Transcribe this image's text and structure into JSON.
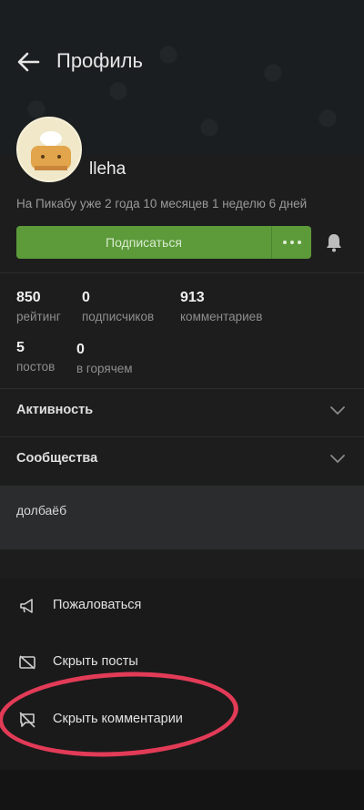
{
  "header": {
    "title": "Профиль",
    "back_icon": "arrow-left-icon"
  },
  "profile": {
    "username": "lleha",
    "since": "На Пикабу уже 2 года 10 месяцев 1 неделю 6 дней",
    "subscribe_label": "Подписаться",
    "more_icon": "more-dots-icon",
    "bell_icon": "bell-icon",
    "accent_color": "#5c9a3a"
  },
  "stats": [
    {
      "value": "850",
      "label": "рейтинг"
    },
    {
      "value": "0",
      "label": "подписчиков"
    },
    {
      "value": "913",
      "label": "комментариев"
    },
    {
      "value": "5",
      "label": "постов"
    },
    {
      "value": "0",
      "label": "в горячем"
    }
  ],
  "sections": [
    {
      "label": "Активность",
      "icon": "chevron-down-icon"
    },
    {
      "label": "Сообщества",
      "icon": "chevron-down-icon"
    }
  ],
  "note": {
    "text": "долбаёб"
  },
  "actions": [
    {
      "label": "Пожаловаться",
      "icon": "megaphone-icon"
    },
    {
      "label": "Скрыть посты",
      "icon": "hide-posts-icon"
    },
    {
      "label": "Скрыть комментарии",
      "icon": "hide-comments-icon"
    }
  ],
  "highlight_color": "#e23b57"
}
